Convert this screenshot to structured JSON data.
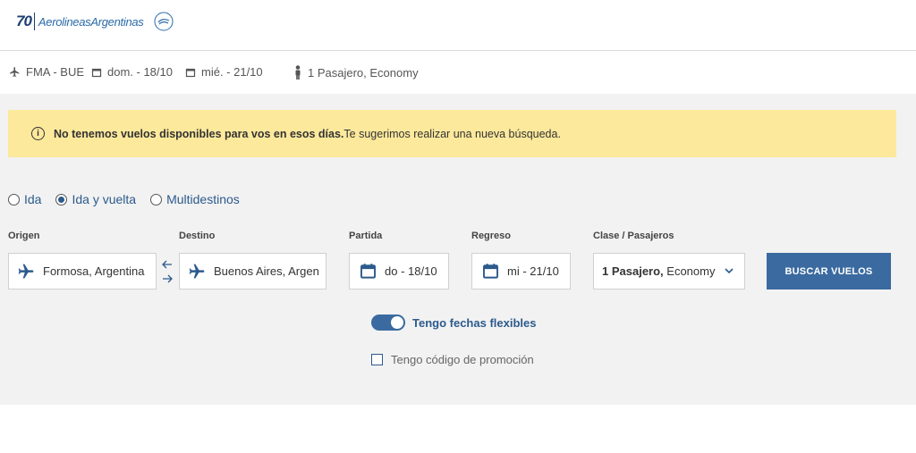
{
  "header": {
    "logo_number": "70",
    "logo_text": "AerolineasArgentinas"
  },
  "summary": {
    "route": "FMA - BUE",
    "departure": "dom. - 18/10",
    "return": "mié. - 21/10",
    "passengers": "1 Pasajero, Economy"
  },
  "alert": {
    "bold_text": "No tenemos vuelos disponibles para vos en esos días.",
    "text": "Te sugerimos realizar una nueva búsqueda."
  },
  "trip_types": [
    {
      "label": "Ida",
      "selected": false
    },
    {
      "label": "Ida y vuelta",
      "selected": true
    },
    {
      "label": "Multidestinos",
      "selected": false
    }
  ],
  "form": {
    "origin_label": "Origen",
    "origin_value": "Formosa, Argentina",
    "destination_label": "Destino",
    "destination_value": "Buenos Aires, Argen",
    "departure_label": "Partida",
    "departure_value": "do - 18/10",
    "return_label": "Regreso",
    "return_value": "mi - 21/10",
    "class_label": "Clase / Pasajeros",
    "class_value_bold": "1 Pasajero,",
    "class_value": " Economy",
    "search_button": "BUSCAR VUELOS"
  },
  "options": {
    "flexible_label": "Tengo fechas flexibles",
    "flexible_on": true,
    "promo_label": "Tengo código de promoción",
    "promo_checked": false
  },
  "colors": {
    "brand_blue": "#3a6aa0",
    "alert_yellow": "#fde99c",
    "panel_bg": "#f2f2f2"
  }
}
